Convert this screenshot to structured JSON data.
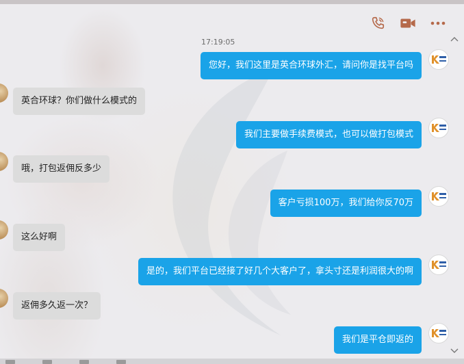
{
  "header": {
    "icons": [
      "phone-icon",
      "video-camera-icon",
      "more-icon"
    ],
    "icon_color": "#b5694a"
  },
  "chat": {
    "timestamp": "17:19:05",
    "messages": [
      {
        "side": "out",
        "text": "您好，我们这里是英合环球外汇，请问你是找平台吗"
      },
      {
        "side": "in",
        "text": "英合环球？你们做什么模式的"
      },
      {
        "side": "out",
        "text": "我们主要做手续费模式，也可以做打包模式"
      },
      {
        "side": "in",
        "text": "哦，打包返佣反多少"
      },
      {
        "side": "out",
        "text": "客户亏损100万，我们给你反70万"
      },
      {
        "side": "in",
        "text": "这么好啊"
      },
      {
        "side": "out",
        "text": "是的，我们平台已经接了好几个大客户了，拿头寸还是利润很大的啊"
      },
      {
        "side": "in",
        "text": "返佣多久返一次？"
      },
      {
        "side": "out",
        "text": "我们是平仓即返的"
      }
    ]
  },
  "colors": {
    "outgoing_bubble": "#1aa3e8",
    "incoming_bubble": "#dcdcdc"
  }
}
